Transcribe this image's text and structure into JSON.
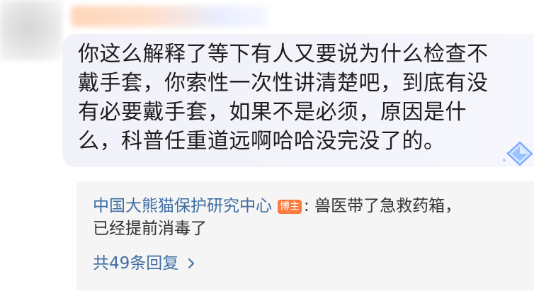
{
  "comment": {
    "text": "你这么解释了等下有人又要说为什么检查不\n戴手套，你索性一次性讲清楚吧，到底有没\n有必要戴手套，如果不是必须，原因是什\n么，科普任重道远啊哈哈没完没了的。",
    "badge_icon": "diamond-badge-icon"
  },
  "reply": {
    "author": "中国大熊猫保护研究中心",
    "author_badge": "博主",
    "separator": ":",
    "text_line1": "兽医带了急救药箱，",
    "text_line2": "已经提前消毒了"
  },
  "view_replies": {
    "label": "共49条回复",
    "icon": "chevron-right-icon"
  },
  "colors": {
    "bubble_bg": "#f2f3fa",
    "reply_bg": "#f5f5f5",
    "link": "#3f6ea3",
    "op_badge": "#fb7a3c"
  }
}
